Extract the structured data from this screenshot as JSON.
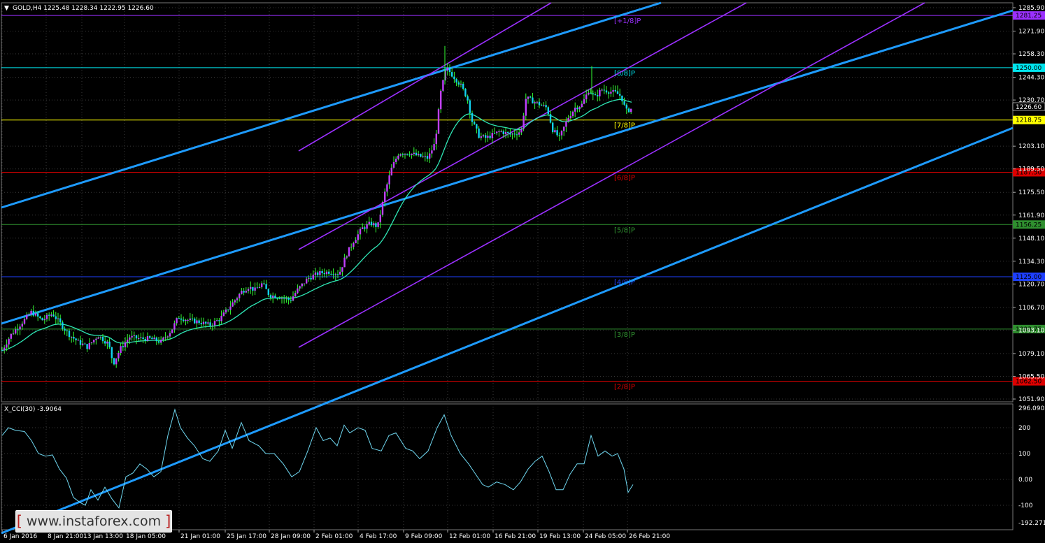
{
  "header": {
    "menu_glyph": "▼",
    "symbol_info": "GOLD,H4 1225.48 1228.34 1222.95 1226.60"
  },
  "indicator": {
    "label": "X_CCI(30) -3.9064",
    "y_axis_labels": [
      "296.0902",
      "200",
      "100",
      "0.00",
      "-100",
      "-192.2717"
    ]
  },
  "price_axis": {
    "labels": [
      "1285.90",
      "1271.90",
      "1258.30",
      "1244.30",
      "1230.70",
      "1203.10",
      "1189.50",
      "1175.50",
      "1161.90",
      "1148.10",
      "1134.30",
      "1120.70",
      "1106.70",
      "1093.10",
      "1079.10",
      "1065.50",
      "1051.90"
    ]
  },
  "time_axis": {
    "labels": [
      "6 Jan 2016",
      "8 Jan 21:00",
      "13 Jan 13:00",
      "18 Jan 05:00",
      "21 Jan 01:00",
      "25 Jan 17:00",
      "28 Jan 09:00",
      "2 Feb 01:00",
      "4 Feb 17:00",
      "9 Feb 09:00",
      "12 Feb 01:00",
      "16 Feb 21:00",
      "19 Feb 13:00",
      "24 Feb 05:00",
      "26 Feb 21:00"
    ]
  },
  "levels": [
    {
      "tag": "1281.25",
      "label": "[+1/8]P",
      "color": "#9b30ff"
    },
    {
      "tag": "1250.00",
      "label": "[8/8]P",
      "color": "#00e5ee"
    },
    {
      "tag": "1218.75",
      "label": "[7/8]P",
      "color": "#ffff00"
    },
    {
      "tag": "1187.50",
      "label": "[6/8]P",
      "color": "#dd0000"
    },
    {
      "tag": "1156.25",
      "label": "[5/8]P",
      "color": "#2f8f2f"
    },
    {
      "tag": "1125.00",
      "label": "[4/8]P",
      "color": "#1e3fff"
    },
    {
      "tag": "1093.75",
      "label": "[3/8]P",
      "color": "#2f8f2f"
    },
    {
      "tag": "1062.50",
      "label": "[2/8]P",
      "color": "#dd0000"
    }
  ],
  "current_price": "1226.60",
  "watermark": {
    "open": "[",
    "text": "www.instaforex.com",
    "close": "]"
  }
}
